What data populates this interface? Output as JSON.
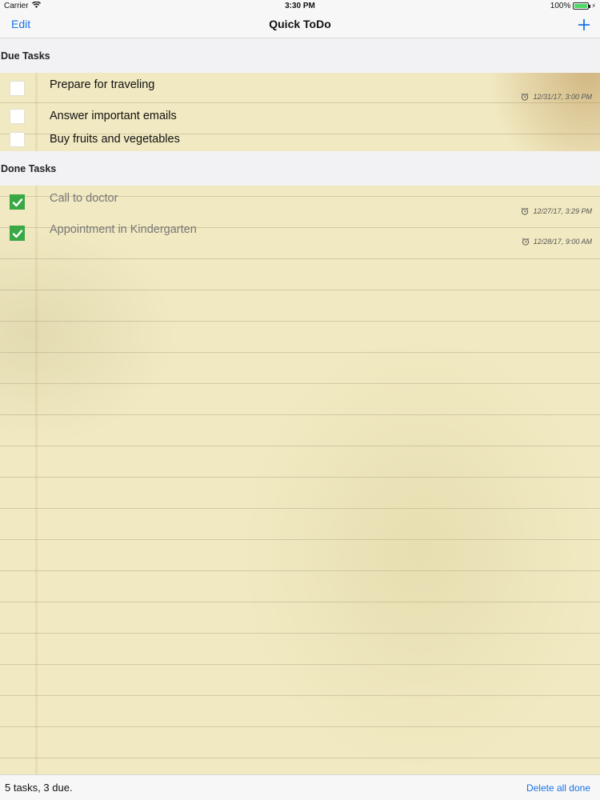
{
  "status_bar": {
    "carrier": "Carrier",
    "time": "3:30 PM",
    "battery": "100%",
    "battery_level": 1.0
  },
  "nav": {
    "edit_label": "Edit",
    "title": "Quick ToDo",
    "add_icon": "plus-icon",
    "add_label": "+"
  },
  "sections": {
    "due_title": "Due Tasks",
    "done_title": "Done Tasks"
  },
  "due_tasks": [
    {
      "title": "Prepare for traveling",
      "due": "12/31/17, 3:00 PM",
      "done": false
    },
    {
      "title": "Answer important emails",
      "due": "",
      "done": false
    },
    {
      "title": "Buy fruits and vegetables",
      "due": "",
      "done": false
    }
  ],
  "done_tasks": [
    {
      "title": "Call to doctor",
      "due": "12/27/17, 3:29 PM",
      "done": true
    },
    {
      "title": "Appointment in Kindergarten",
      "due": "12/28/17, 9:00 AM",
      "done": true
    }
  ],
  "toolbar": {
    "summary": "5 tasks, 3 due.",
    "delete_label": "Delete all done"
  },
  "colors": {
    "accent": "#1a73e8",
    "check_green": "#39a845",
    "paper": "#f1e9c1"
  }
}
